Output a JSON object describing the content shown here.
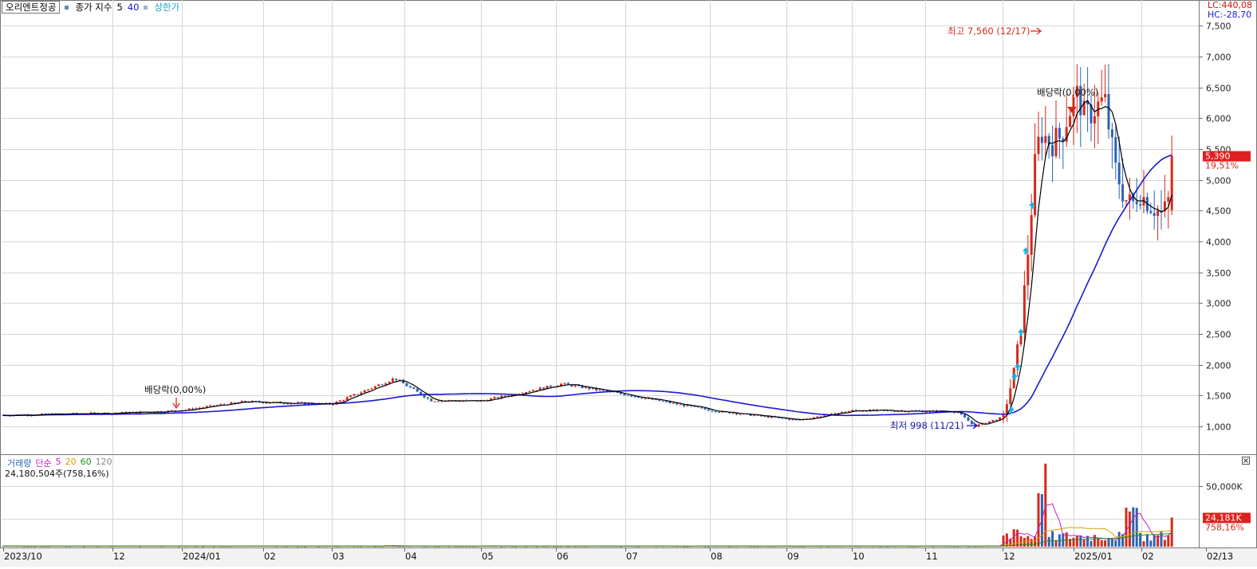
{
  "header": {
    "stock_name": "오리엔트정공",
    "line_label": "종가 지수",
    "ma_short": "5",
    "ma_long": "40",
    "limit_label": "상한가",
    "lc": "LC:440,08",
    "hc": "HC:-28,70"
  },
  "volume_panel": {
    "label": "거래량",
    "ma_label": "단순",
    "ma_5": "5",
    "ma_20": "20",
    "ma_60": "60",
    "ma_120": "120",
    "total": "24,180,504주(758,16%)",
    "last_badge": "24,181K",
    "last_pct": "758,16%"
  },
  "price_badge": {
    "value": "5,390",
    "pct": "19,51%"
  },
  "colors": {
    "up": "#d42a1c",
    "down": "#2b63b5",
    "ma_short": "#000000",
    "ma_long": "#1a1ad0",
    "limit_up": "#18b0e0",
    "grid": "#d6d6d6",
    "badge_bg": "#e02020"
  },
  "chart_data": [
    {
      "type": "candlestick",
      "title": "",
      "x_labels": [
        "2023/10",
        "12",
        "2024/01",
        "02",
        "03",
        "04",
        "05",
        "06",
        "07",
        "08",
        "09",
        "10",
        "11",
        "12",
        "2025/01",
        "02",
        "02/13"
      ],
      "y_ticks": [
        1000,
        1500,
        2000,
        2500,
        3000,
        3500,
        4000,
        4500,
        5000,
        5500,
        6000,
        6500,
        7000,
        7500
      ],
      "y_tick_labels": [
        "1,000",
        "1,500",
        "2,000",
        "2,500",
        "3,000",
        "3,500",
        "4,000",
        "4,500",
        "5,000",
        "5,500",
        "6,000",
        "6,500",
        "7,000",
        "7,500"
      ],
      "ylim": [
        560,
        7920
      ],
      "last_close": 5390,
      "last_change_pct": 19.51,
      "annotations": {
        "high": "최고 7,560 (12/17)",
        "low": "최저 998 (11/21)",
        "ex_div_1": "배당락(0,00%)",
        "ex_div_2": "배당락(0,00%)"
      },
      "close_series": [
        {
          "date": "2023/10",
          "close": 1180
        },
        {
          "date": "2023/11",
          "close": 1215
        },
        {
          "date": "2023/12",
          "close": 1240
        },
        {
          "date": "2024/01",
          "close": 1260
        },
        {
          "date": "2024/02",
          "close": 1400
        },
        {
          "date": "2024/03",
          "close": 1360
        },
        {
          "date": "2024/03 late",
          "close": 1780
        },
        {
          "date": "2024/04",
          "close": 1420
        },
        {
          "date": "2024/05",
          "close": 1410
        },
        {
          "date": "2024/06",
          "close": 1690
        },
        {
          "date": "2024/07",
          "close": 1500
        },
        {
          "date": "2024/08",
          "close": 1250
        },
        {
          "date": "2024/09",
          "close": 1100
        },
        {
          "date": "2024/10",
          "close": 1260
        },
        {
          "date": "2024/11",
          "close": 1240
        },
        {
          "date": "2024/11/21",
          "close": 1000
        },
        {
          "date": "2024/12/17",
          "close": 5700
        },
        {
          "date": "2025/01",
          "close": 6400
        },
        {
          "date": "2025/02",
          "close": 4600
        },
        {
          "date": "2025/02/13",
          "close": 5390
        }
      ]
    },
    {
      "type": "bar",
      "title": "",
      "series_label": "거래량",
      "y_ticks": [
        50000
      ],
      "y_tick_labels": [
        "50,000K"
      ],
      "last_value_k": 24181
    }
  ]
}
